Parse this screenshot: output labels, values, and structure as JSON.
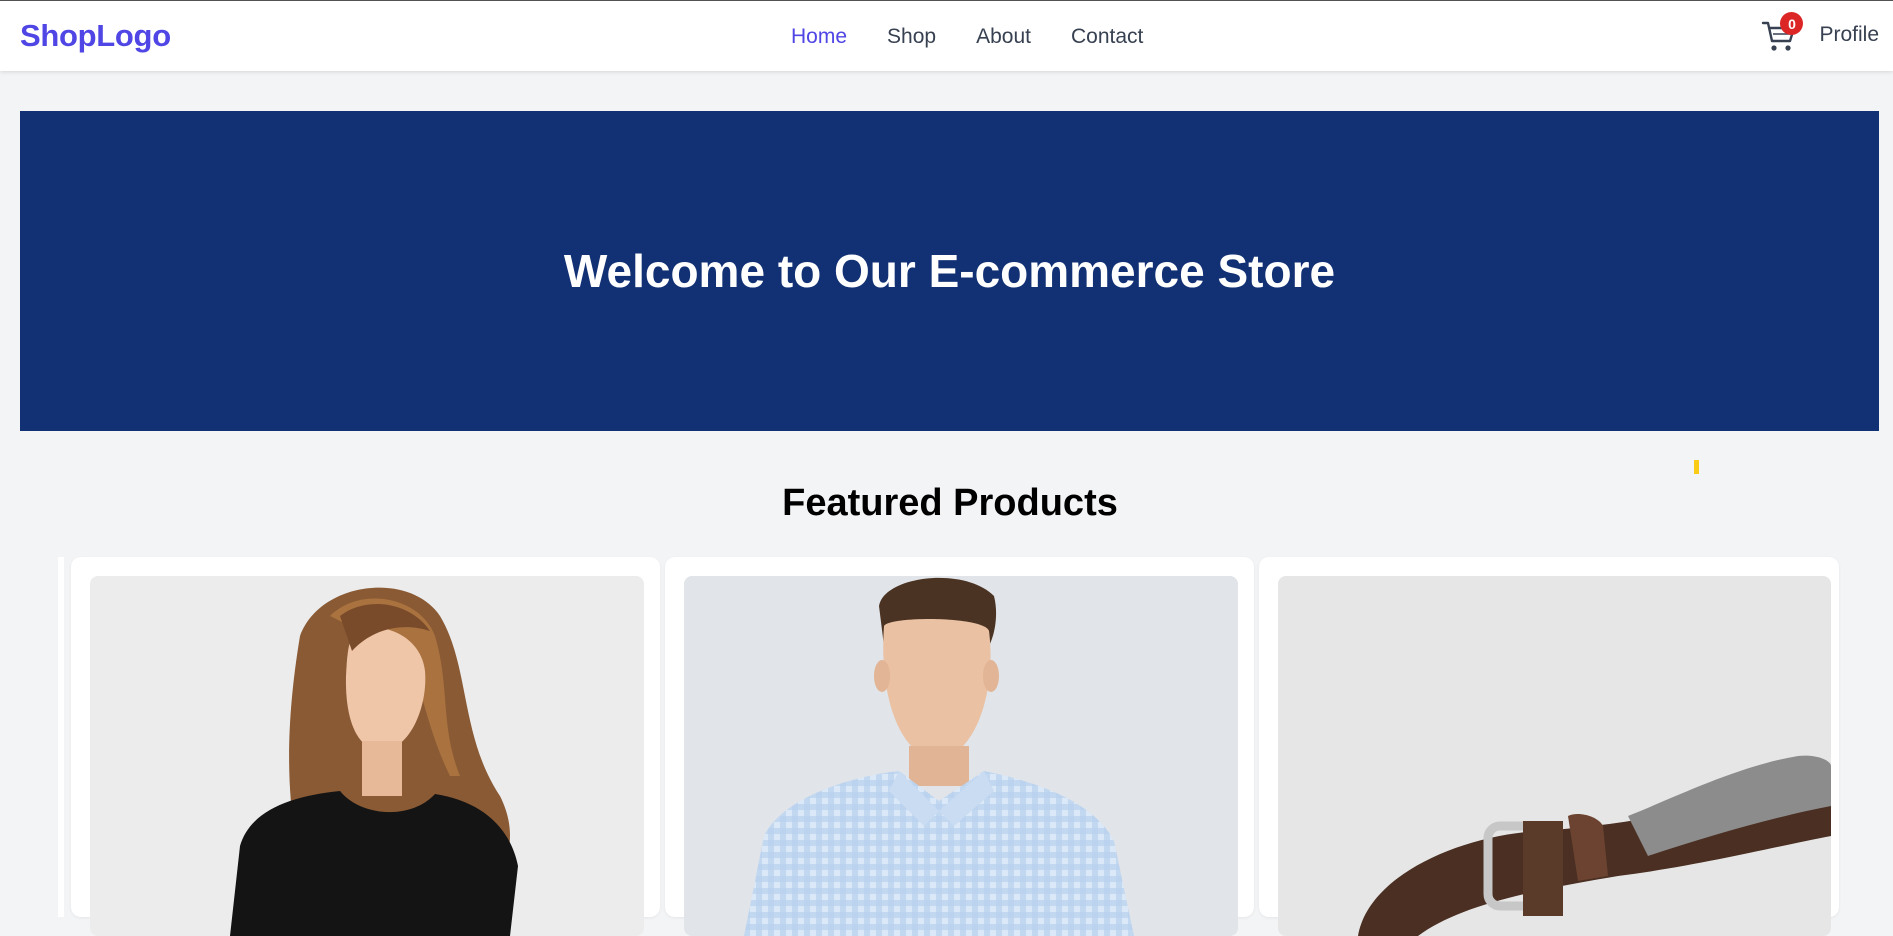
{
  "header": {
    "logo": "ShopLogo",
    "nav": [
      {
        "label": "Home",
        "active": true
      },
      {
        "label": "Shop",
        "active": false
      },
      {
        "label": "About",
        "active": false
      },
      {
        "label": "Contact",
        "active": false
      }
    ],
    "cart_count": "0",
    "profile_label": "Profile"
  },
  "hero": {
    "title": "Welcome to Our E-commerce Store",
    "background": "#123174"
  },
  "featured": {
    "title": "Featured Products",
    "products": [
      {
        "image": "woman-in-black-tshirt"
      },
      {
        "image": "man-in-gingham-shirt"
      },
      {
        "image": "leather-belt"
      }
    ]
  },
  "colors": {
    "accent": "#4f46e5",
    "badge": "#dc2626"
  }
}
